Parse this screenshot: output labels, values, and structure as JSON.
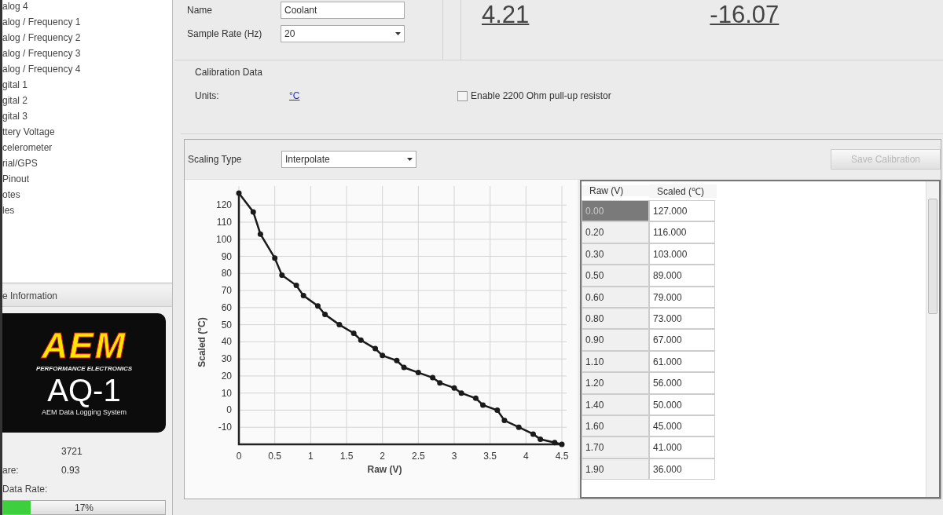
{
  "sidebar": {
    "items": [
      "alog 4",
      "alog / Frequency 1",
      "alog / Frequency 2",
      "alog / Frequency 3",
      "alog / Frequency 4",
      "gital 1",
      "gital 2",
      "gital 3",
      "ttery Voltage",
      "celerometer",
      "rial/GPS",
      "Pinout",
      "otes",
      "les"
    ],
    "info_header": "e Information",
    "logo": {
      "brand": "AEM",
      "tagline": "PERFORMANCE ELECTRONICS",
      "model": "AQ-1",
      "subtitle": "AEM Data Logging System"
    },
    "info_rows": [
      {
        "label": "",
        "value": "3721"
      },
      {
        "label": "are:",
        "value": "0.93"
      },
      {
        "label": "Data Rate:",
        "value": ""
      }
    ],
    "data_rate": {
      "level": 0.17,
      "reading": "17%"
    }
  },
  "channel": {
    "name_label": "Name",
    "name_value": "Coolant",
    "rate_label": "Sample Rate (Hz)",
    "rate_value": "20"
  },
  "readings": [
    "4.21",
    "-16.07"
  ],
  "calibration": {
    "title": "Calibration Data",
    "units_label": "Units:",
    "units_value": "°C",
    "pullup": {
      "label": "Enable 2200 Ohm pull-up resistor",
      "checked": false
    }
  },
  "scaling": {
    "label": "Scaling Type",
    "value": "Interpolate",
    "save_button": {
      "label": "Save Calibration",
      "disabled": true
    }
  },
  "chart_data": {
    "type": "line",
    "xlabel": "Raw (V)",
    "ylabel": "Scaled (°C)",
    "x": [
      0,
      0.2,
      0.3,
      0.5,
      0.6,
      0.8,
      0.9,
      1.1,
      1.2,
      1.4,
      1.6,
      1.7,
      1.9,
      2.0,
      2.2,
      2.3,
      2.5,
      2.7,
      2.8,
      3.0,
      3.1,
      3.3,
      3.4,
      3.6,
      3.7,
      3.9,
      4.1,
      4.2,
      4.4,
      4.5
    ],
    "grid": true,
    "series": [
      {
        "color": "#1a1a1a",
        "marker": true,
        "values": [
          127,
          116,
          103,
          89,
          79,
          73,
          67,
          61,
          56,
          50,
          45,
          41,
          36,
          32,
          29,
          25,
          22,
          19,
          16,
          13,
          10,
          7,
          3,
          0,
          -6,
          -10,
          -14,
          -17,
          -19,
          -20
        ]
      }
    ],
    "xlim": [
      0,
      4.5
    ],
    "ylim": [
      -20,
      127
    ],
    "xticks": [
      0,
      0.5,
      1,
      1.5,
      2,
      2.5,
      3,
      3.5,
      4,
      4.5
    ],
    "yticks": [
      -10,
      0,
      10,
      20,
      30,
      40,
      50,
      60,
      70,
      80,
      90,
      100,
      110,
      120
    ]
  },
  "table": {
    "columns": [
      "Raw (V)",
      "Scaled (℃)"
    ],
    "rows": [
      {
        "raw": "0.00",
        "scaled": "127.000",
        "selected": true
      },
      {
        "raw": "0.20",
        "scaled": "116.000",
        "selected": false
      },
      {
        "raw": "0.30",
        "scaled": "103.000",
        "selected": false
      },
      {
        "raw": "0.50",
        "scaled": "89.000",
        "selected": false
      },
      {
        "raw": "0.60",
        "scaled": "79.000",
        "selected": false
      },
      {
        "raw": "0.80",
        "scaled": "73.000",
        "selected": false
      },
      {
        "raw": "0.90",
        "scaled": "67.000",
        "selected": false
      },
      {
        "raw": "1.10",
        "scaled": "61.000",
        "selected": false
      },
      {
        "raw": "1.20",
        "scaled": "56.000",
        "selected": false
      },
      {
        "raw": "1.40",
        "scaled": "50.000",
        "selected": false
      },
      {
        "raw": "1.60",
        "scaled": "45.000",
        "selected": false
      },
      {
        "raw": "1.70",
        "scaled": "41.000",
        "selected": false
      },
      {
        "raw": "1.90",
        "scaled": "36.000",
        "selected": false
      }
    ]
  }
}
